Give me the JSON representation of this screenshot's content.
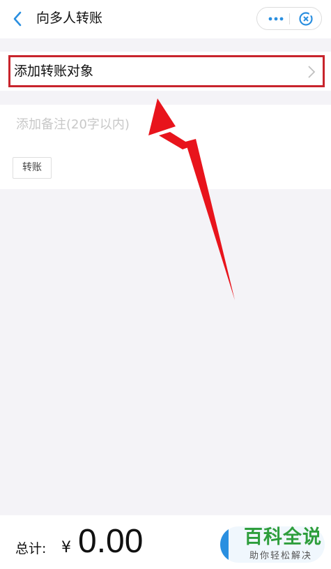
{
  "header": {
    "title": "向多人转账",
    "back_icon": "chevron-left-icon",
    "more_icon": "more-dots-icon",
    "close_icon": "mini-program-close-icon"
  },
  "recipients": {
    "label": "添加转账对象",
    "chevron_icon": "chevron-right-icon"
  },
  "note": {
    "placeholder": "添加备注(20字以内)",
    "quick_tag": "转账"
  },
  "footer": {
    "total_label": "总计:",
    "currency": "¥",
    "amount": "0.00"
  },
  "watermark": {
    "main": "百科全说",
    "sub": "助你轻松解决"
  },
  "colors": {
    "accent": "#2a8fe0",
    "highlight": "#c8242c",
    "arrow": "#e8141c",
    "watermark_green": "#2e9e3c",
    "background": "#f4f3f7"
  }
}
